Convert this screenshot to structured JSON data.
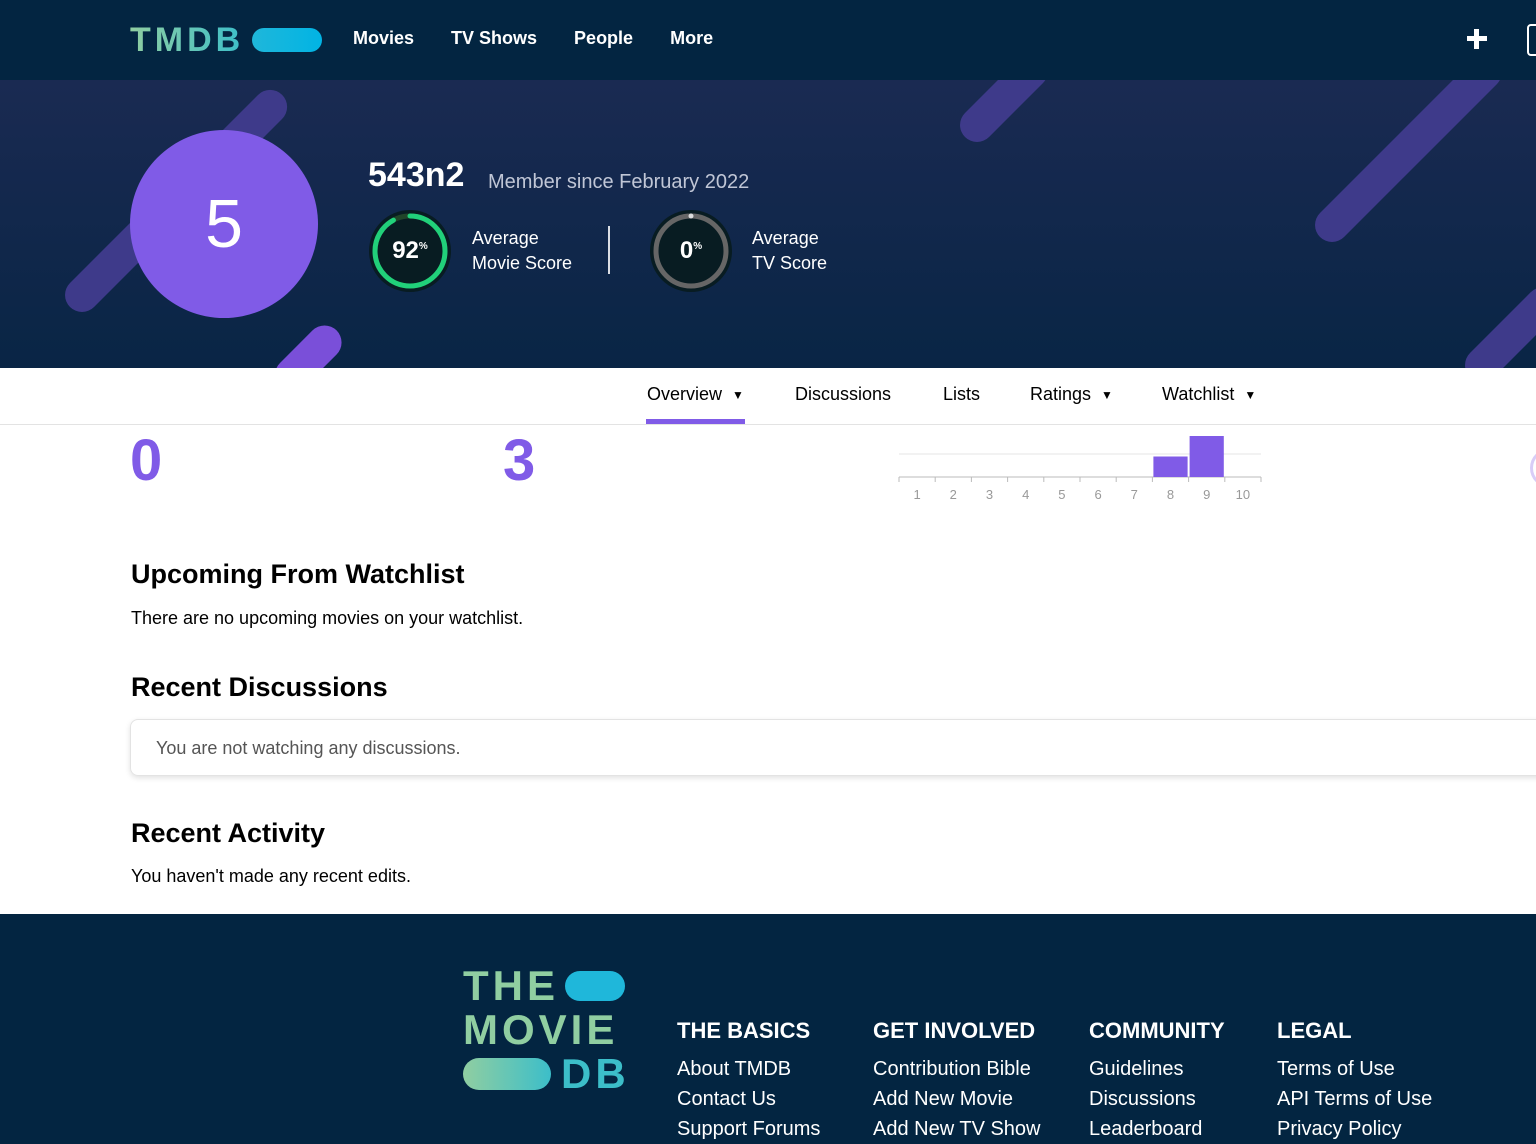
{
  "nav": {
    "logo_text": "TMDB",
    "links": [
      "Movies",
      "TV Shows",
      "People",
      "More"
    ],
    "plus_icon": "plus-icon"
  },
  "profile": {
    "avatar_letter": "5",
    "username": "543n2",
    "member_since": "Member since February 2022",
    "movie_score": {
      "value": "92",
      "unit": "%",
      "percent": 92,
      "label_line1": "Average",
      "label_line2": "Movie Score",
      "color": "#21d07a"
    },
    "tv_score": {
      "value": "0",
      "unit": "%",
      "percent": 0,
      "label_line1": "Average",
      "label_line2": "TV Score",
      "color": "#666666"
    },
    "avatar_color": "#805be7"
  },
  "tabs": [
    {
      "label": "Overview",
      "dropdown": true,
      "active": true
    },
    {
      "label": "Discussions",
      "dropdown": false
    },
    {
      "label": "Lists",
      "dropdown": false
    },
    {
      "label": "Ratings",
      "dropdown": true
    },
    {
      "label": "Watchlist",
      "dropdown": true
    }
  ],
  "stats": {
    "first": "0",
    "second": "3"
  },
  "chart_data": {
    "type": "bar",
    "categories": [
      "1",
      "2",
      "3",
      "4",
      "5",
      "6",
      "7",
      "8",
      "9",
      "10"
    ],
    "values": [
      0,
      0,
      0,
      0,
      0,
      0,
      0,
      1,
      2,
      0
    ],
    "color": "#805be7"
  },
  "sections": {
    "upcoming_title": "Upcoming From Watchlist",
    "upcoming_text": "There are no upcoming movies on your watchlist.",
    "discussions_title": "Recent Discussions",
    "discussions_text": "You are not watching any discussions.",
    "activity_title": "Recent Activity",
    "activity_text": "You haven't made any recent edits."
  },
  "footer": {
    "logo_lines": [
      "THE",
      "MOVIE",
      "DB"
    ],
    "columns": [
      {
        "title": "THE BASICS",
        "links": [
          "About TMDB",
          "Contact Us",
          "Support Forums"
        ]
      },
      {
        "title": "GET INVOLVED",
        "links": [
          "Contribution Bible",
          "Add New Movie",
          "Add New TV Show"
        ]
      },
      {
        "title": "COMMUNITY",
        "links": [
          "Guidelines",
          "Discussions",
          "Leaderboard"
        ]
      },
      {
        "title": "LEGAL",
        "links": [
          "Terms of Use",
          "API Terms of Use",
          "Privacy Policy"
        ]
      }
    ]
  }
}
